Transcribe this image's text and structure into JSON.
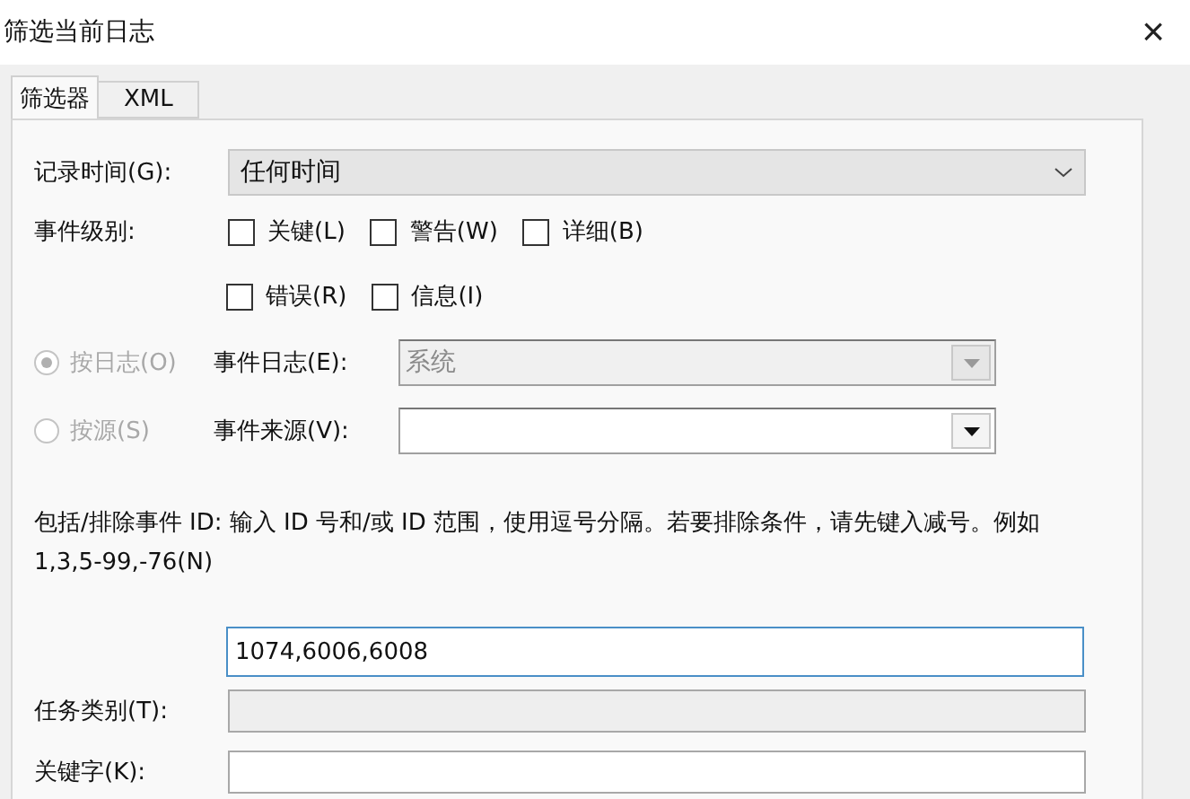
{
  "window": {
    "title": "筛选当前日志",
    "close": "×"
  },
  "tabs": [
    {
      "label": "筛选器",
      "selected": true
    },
    {
      "label": "XML",
      "selected": false
    }
  ],
  "logged": {
    "label": "记录时间(G):",
    "value": "任何时间"
  },
  "event_level": {
    "label": "事件级别:",
    "options": [
      {
        "label": "关键(L)",
        "checked": false
      },
      {
        "label": "警告(W)",
        "checked": false
      },
      {
        "label": "详细(B)",
        "checked": false
      },
      {
        "label": "错误(R)",
        "checked": false
      },
      {
        "label": "信息(I)",
        "checked": false
      }
    ]
  },
  "sources": [
    {
      "radio": "按日志(O)",
      "selected": true,
      "disabled": true,
      "field_label": "事件日志(E):",
      "value": "系统",
      "field_disabled": true
    },
    {
      "radio": "按源(S)",
      "selected": false,
      "disabled": true,
      "field_label": "事件来源(V):",
      "field_disabled": false
    }
  ],
  "event_ids": {
    "description": "包括/排除事件 ID: 输入 ID 号和/或 ID 范围，使用逗号分隔。若要排除条件，请先键入减号。例如 1,3,5-99,-76(N)",
    "value": "1074,6006,6008"
  },
  "task_category": {
    "label": "任务类别(T):"
  },
  "keywords": {
    "label": "关键字(K):"
  }
}
